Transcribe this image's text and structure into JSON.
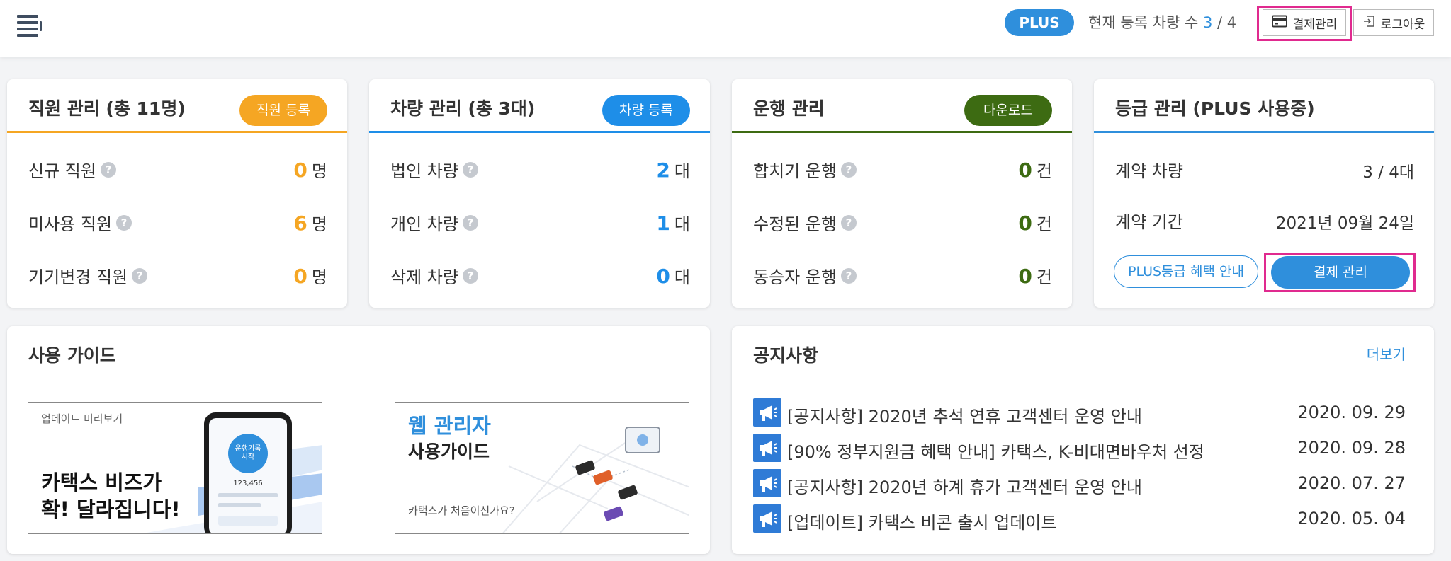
{
  "header": {
    "plan_badge": "PLUS",
    "vehicle_count_label": "현재 등록 차량 수",
    "vehicle_count_current": "3",
    "vehicle_count_sep": "/",
    "vehicle_count_max": "4",
    "billing_label": "결제관리",
    "logout_label": "로그아웃",
    "highlight_color": "#e02a8f"
  },
  "employee_card": {
    "title": "직원 관리 (총 11명)",
    "button": "직원 등록",
    "accent": "#f5a623",
    "rows": [
      {
        "label": "신규 직원",
        "value": "0",
        "unit": "명"
      },
      {
        "label": "미사용 직원",
        "value": "6",
        "unit": "명"
      },
      {
        "label": "기기변경 직원",
        "value": "0",
        "unit": "명"
      }
    ]
  },
  "vehicle_card": {
    "title": "차량 관리 (총 3대)",
    "button": "차량 등록",
    "accent": "#1e8ee8",
    "rows": [
      {
        "label": "법인 차량",
        "value": "2",
        "unit": "대"
      },
      {
        "label": "개인 차량",
        "value": "1",
        "unit": "대"
      },
      {
        "label": "삭제 차량",
        "value": "0",
        "unit": "대"
      }
    ]
  },
  "driving_card": {
    "title": "운행 관리",
    "button": "다운로드",
    "accent": "#3d6b12",
    "rows": [
      {
        "label": "합치기 운행",
        "value": "0",
        "unit": "건"
      },
      {
        "label": "수정된 운행",
        "value": "0",
        "unit": "건"
      },
      {
        "label": "동승자 운행",
        "value": "0",
        "unit": "건"
      }
    ]
  },
  "grade_card": {
    "title": "등급 관리 (PLUS 사용중)",
    "accent": "#2f8fdc",
    "rows": [
      {
        "label": "계약 차량",
        "value": "3 / 4대"
      },
      {
        "label": "계약 기간",
        "value": "2021년 09월 24일"
      }
    ],
    "benefit_button": "PLUS등급 혜택 안내",
    "billing_button": "결제 관리"
  },
  "guide": {
    "title": "사용 가이드",
    "banner1": {
      "tag": "업데이트 미리보기",
      "line1": "카택스 비즈가",
      "line2": "확! 달라집니다!",
      "phone_top": "운행기록 시작",
      "phone_value": "123,456"
    },
    "banner2": {
      "title1": "웹 관리자",
      "title2": "사용가이드",
      "caption": "카택스가 처음이신가요?"
    }
  },
  "notices": {
    "title": "공지사항",
    "more": "더보기",
    "items": [
      {
        "title": "[공지사항] 2020년 추석 연휴 고객센터 운영 안내",
        "date": "2020. 09. 29"
      },
      {
        "title": "[90% 정부지원금 혜택 안내] 카택스, K-비대면바우처 선정",
        "date": "2020. 09. 28"
      },
      {
        "title": "[공지사항] 2020년 하계 휴가 고객센터 운영 안내",
        "date": "2020. 07. 27"
      },
      {
        "title": "[업데이트] 카택스 비콘 출시 업데이트",
        "date": "2020. 05. 04"
      }
    ]
  }
}
